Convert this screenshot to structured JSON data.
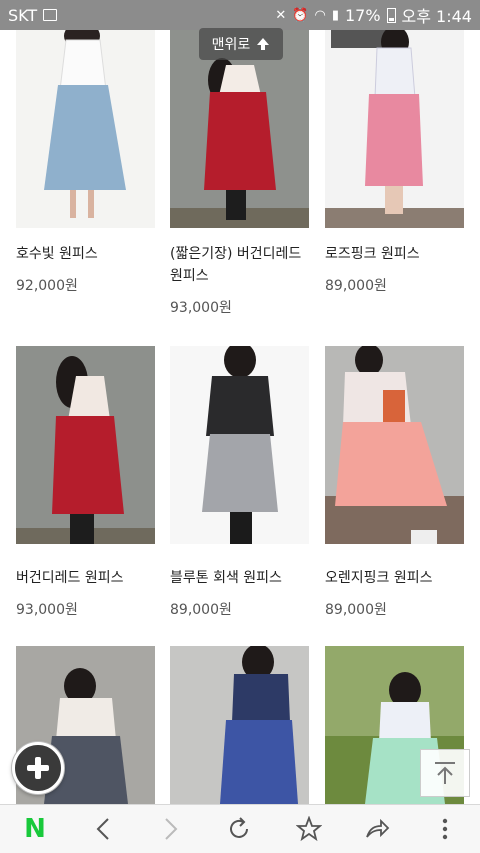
{
  "status_bar": {
    "carrier": "SKT",
    "battery": "17%",
    "time": "오후 1:44"
  },
  "back_to_top": {
    "label": "맨위로"
  },
  "products": [
    {
      "name": "호수빛 원피스",
      "price": "92,000원",
      "dress_color": "#8fb0cc"
    },
    {
      "name": "(짧은기장) 버건디레드 원피스",
      "price": "93,000원",
      "dress_color": "#b51d2c"
    },
    {
      "name": "로즈핑크 원피스",
      "price": "89,000원",
      "dress_color": "#e889a0"
    },
    {
      "name": "버건디레드 원피스",
      "price": "93,000원",
      "dress_color": "#b51d2c"
    },
    {
      "name": "블루톤 회색 원피스",
      "price": "89,000원",
      "dress_color": "#a3a5aa"
    },
    {
      "name": "오렌지핑크 원피스",
      "price": "89,000원",
      "dress_color": "#f3a39a"
    },
    {
      "name": "",
      "price": "",
      "dress_color": "#4f5563"
    },
    {
      "name": "",
      "price": "",
      "dress_color": "#3d55a5"
    },
    {
      "name": "",
      "price": "",
      "dress_color": "#a6e2c6"
    }
  ],
  "toolbar": {
    "naver_logo": "N",
    "accent": "#19c93b"
  }
}
